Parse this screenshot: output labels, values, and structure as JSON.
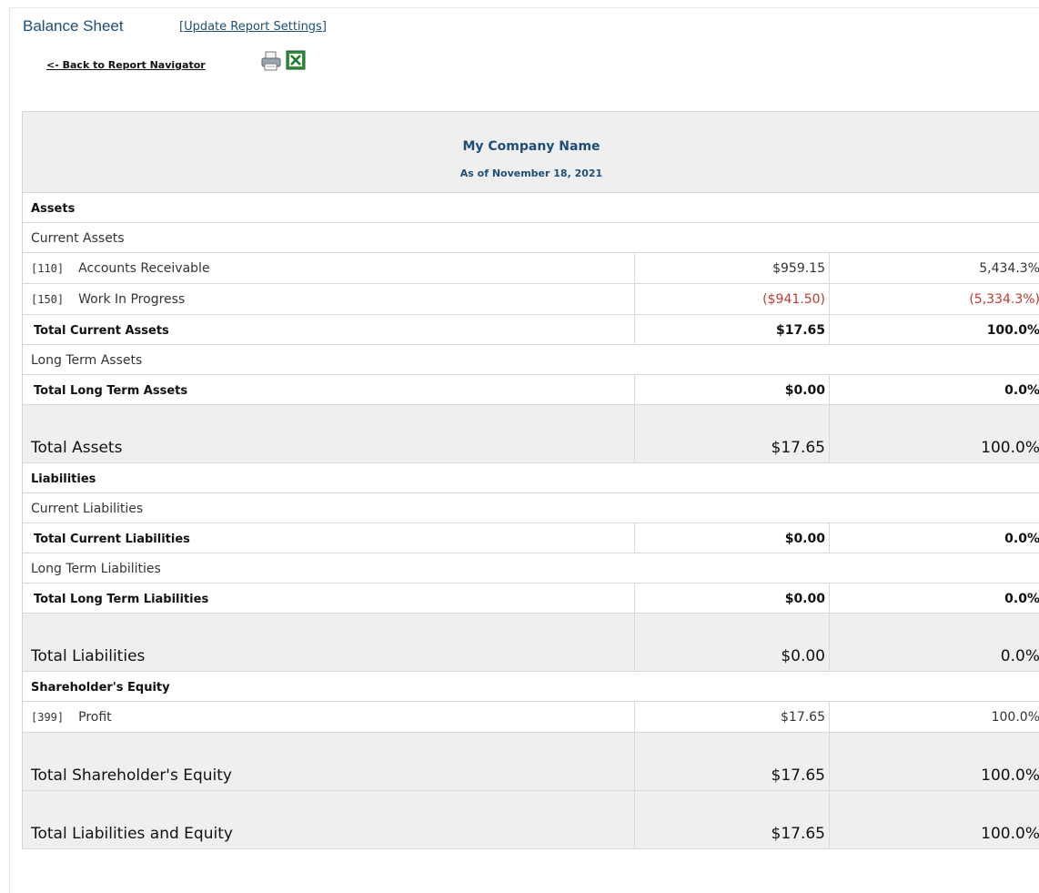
{
  "header": {
    "title": "Balance Sheet",
    "settings_link": "[Update Report Settings]",
    "back_link": "<- Back to Report Navigator",
    "print_icon": "printer-icon",
    "excel_icon": "excel-icon"
  },
  "report": {
    "company": "My Company Name",
    "as_of": "As of November 18, 2021"
  },
  "assets": {
    "heading": "Assets",
    "current_heading": "Current Assets",
    "rows": [
      {
        "code": "[110]",
        "name": "Accounts Receivable",
        "amount": "$959.15",
        "percent": "5,434.3%"
      },
      {
        "code": "[150]",
        "name": "Work In Progress",
        "amount": "($941.50)",
        "percent": "(5,334.3%)"
      }
    ],
    "total_current": {
      "label": "Total Current Assets",
      "amount": "$17.65",
      "percent": "100.0%"
    },
    "long_term_heading": "Long Term Assets",
    "total_long_term": {
      "label": "Total Long Term Assets",
      "amount": "$0.00",
      "percent": "0.0%"
    },
    "total": {
      "label": "Total Assets",
      "amount": "$17.65",
      "percent": "100.0%"
    }
  },
  "liabilities": {
    "heading": "Liabilities",
    "current_heading": "Current Liabilities",
    "total_current": {
      "label": "Total Current Liabilities",
      "amount": "$0.00",
      "percent": "0.0%"
    },
    "long_term_heading": "Long Term Liabilities",
    "total_long_term": {
      "label": "Total Long Term Liabilities",
      "amount": "$0.00",
      "percent": "0.0%"
    },
    "total": {
      "label": "Total Liabilities",
      "amount": "$0.00",
      "percent": "0.0%"
    }
  },
  "equity": {
    "heading": "Shareholder's Equity",
    "rows": [
      {
        "code": "[399]",
        "name": "Profit",
        "amount": "$17.65",
        "percent": "100.0%"
      }
    ],
    "total": {
      "label": "Total Shareholder's Equity",
      "amount": "$17.65",
      "percent": "100.0%"
    }
  },
  "grand_total": {
    "label": "Total Liabilities and Equity",
    "amount": "$17.65",
    "percent": "100.0%"
  },
  "colors": {
    "accent": "#1e4e78",
    "negative": "#c0392b",
    "band": "#efefef"
  }
}
